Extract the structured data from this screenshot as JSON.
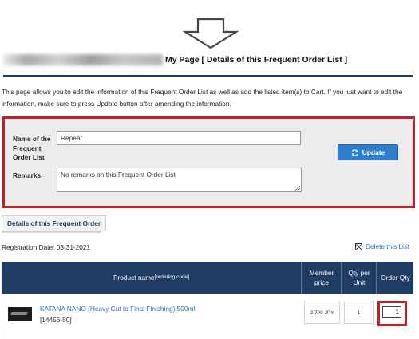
{
  "header": {
    "page_title": "My Page [ Details of this Frequent Order List ]"
  },
  "intro_text": "This page allows you to edit the information of this Frequent Order List as well as add the listed item(s) to Cart. If you just want to edit the information, make sure to press Update button after amending the information.",
  "form": {
    "name_label": "Name of the Frequent Order List",
    "name_value": "Repeat",
    "remarks_label": "Remarks",
    "remarks_value": "No remarks on this Frequent Order List",
    "update_label": "Update"
  },
  "details": {
    "tab_label": "Details of this Frequent Order",
    "registration": "Registration Date: 03-31-2021",
    "delete_label": "Delete this List"
  },
  "table": {
    "headers": {
      "product": "Product name",
      "product_sub": "[ordering code]",
      "price": "Member price",
      "unit": "Qty per Unit",
      "qty": "Order Qty"
    },
    "rows": [
      {
        "name": "KATANA NANO (Heavy Cut to Final Finishing) 500ml",
        "code": "[14456-50]",
        "price": "2,700 JPY",
        "unit": "1",
        "qty": "1"
      }
    ]
  },
  "colors": {
    "header_navy": "#1f3d63",
    "highlight_red": "#c0202a",
    "button_blue": "#2f7fd0",
    "link_blue": "#2d6fb8"
  }
}
